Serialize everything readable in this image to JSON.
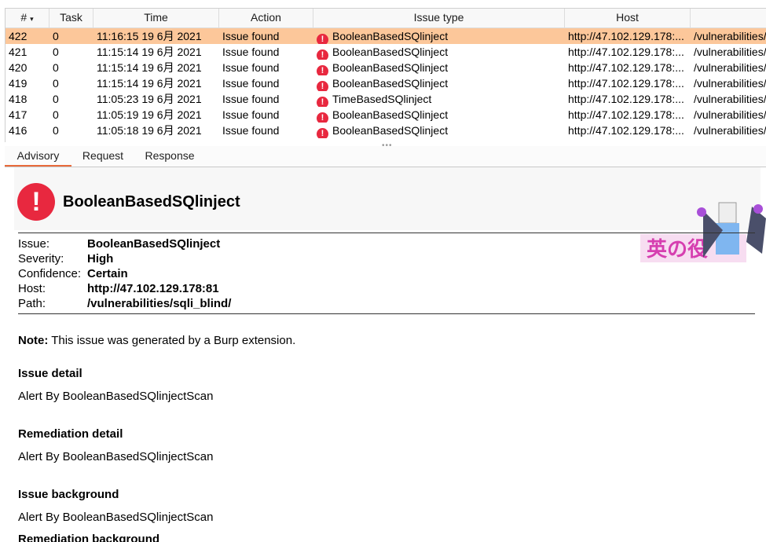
{
  "table": {
    "columns": [
      "#",
      "Task",
      "Time",
      "Action",
      "Issue type",
      "Host"
    ],
    "rows": [
      {
        "num": "422",
        "task": "0",
        "time": "11:16:15 19 6月 2021",
        "action": "Issue found",
        "issue": "BooleanBasedSQlinject",
        "host": "http://47.102.129.178:...",
        "path": "/vulnerabilities/"
      },
      {
        "num": "421",
        "task": "0",
        "time": "11:15:14 19 6月 2021",
        "action": "Issue found",
        "issue": "BooleanBasedSQlinject",
        "host": "http://47.102.129.178:...",
        "path": "/vulnerabilities/"
      },
      {
        "num": "420",
        "task": "0",
        "time": "11:15:14 19 6月 2021",
        "action": "Issue found",
        "issue": "BooleanBasedSQlinject",
        "host": "http://47.102.129.178:...",
        "path": "/vulnerabilities/"
      },
      {
        "num": "419",
        "task": "0",
        "time": "11:15:14 19 6月 2021",
        "action": "Issue found",
        "issue": "BooleanBasedSQlinject",
        "host": "http://47.102.129.178:...",
        "path": "/vulnerabilities/"
      },
      {
        "num": "418",
        "task": "0",
        "time": "11:05:23 19 6月 2021",
        "action": "Issue found",
        "issue": "TimeBasedSQlinject",
        "host": "http://47.102.129.178:...",
        "path": "/vulnerabilities/"
      },
      {
        "num": "417",
        "task": "0",
        "time": "11:05:19 19 6月 2021",
        "action": "Issue found",
        "issue": "BooleanBasedSQlinject",
        "host": "http://47.102.129.178:...",
        "path": "/vulnerabilities/"
      },
      {
        "num": "416",
        "task": "0",
        "time": "11:05:18 19 6月 2021",
        "action": "Issue found",
        "issue": "BooleanBasedSQlinject",
        "host": "http://47.102.129.178:...",
        "path": "/vulnerabilities/"
      }
    ],
    "selected_index": 0
  },
  "tabs": [
    "Advisory",
    "Request",
    "Response"
  ],
  "advisory": {
    "title": "BooleanBasedSQlinject",
    "fields": [
      {
        "key": "Issue:",
        "value": "BooleanBasedSQlinject"
      },
      {
        "key": "Severity:",
        "value": "High"
      },
      {
        "key": "Confidence:",
        "value": "Certain"
      },
      {
        "key": "Host:",
        "value": "http://47.102.129.178:81"
      },
      {
        "key": "Path:",
        "value": "/vulnerabilities/sqli_blind/"
      }
    ],
    "note_label": "Note:",
    "note_text": " This issue was generated by a Burp extension.",
    "sections": [
      {
        "heading": "Issue detail",
        "text": "Alert By BooleanBasedSQlinjectScan"
      },
      {
        "heading": "Remediation detail",
        "text": "Alert By BooleanBasedSQlinjectScan"
      },
      {
        "heading": "Issue background",
        "text": "Alert By BooleanBasedSQlinjectScan"
      },
      {
        "heading": "Remediation background",
        "text": ""
      }
    ]
  },
  "watermark": {
    "text": "英の役"
  },
  "colors": {
    "selected_row": "#fcc79a",
    "error_red": "#e8283f",
    "tab_accent": "#e86a3a"
  },
  "icons": {
    "issue_icon": "error-exclamation-icon"
  }
}
